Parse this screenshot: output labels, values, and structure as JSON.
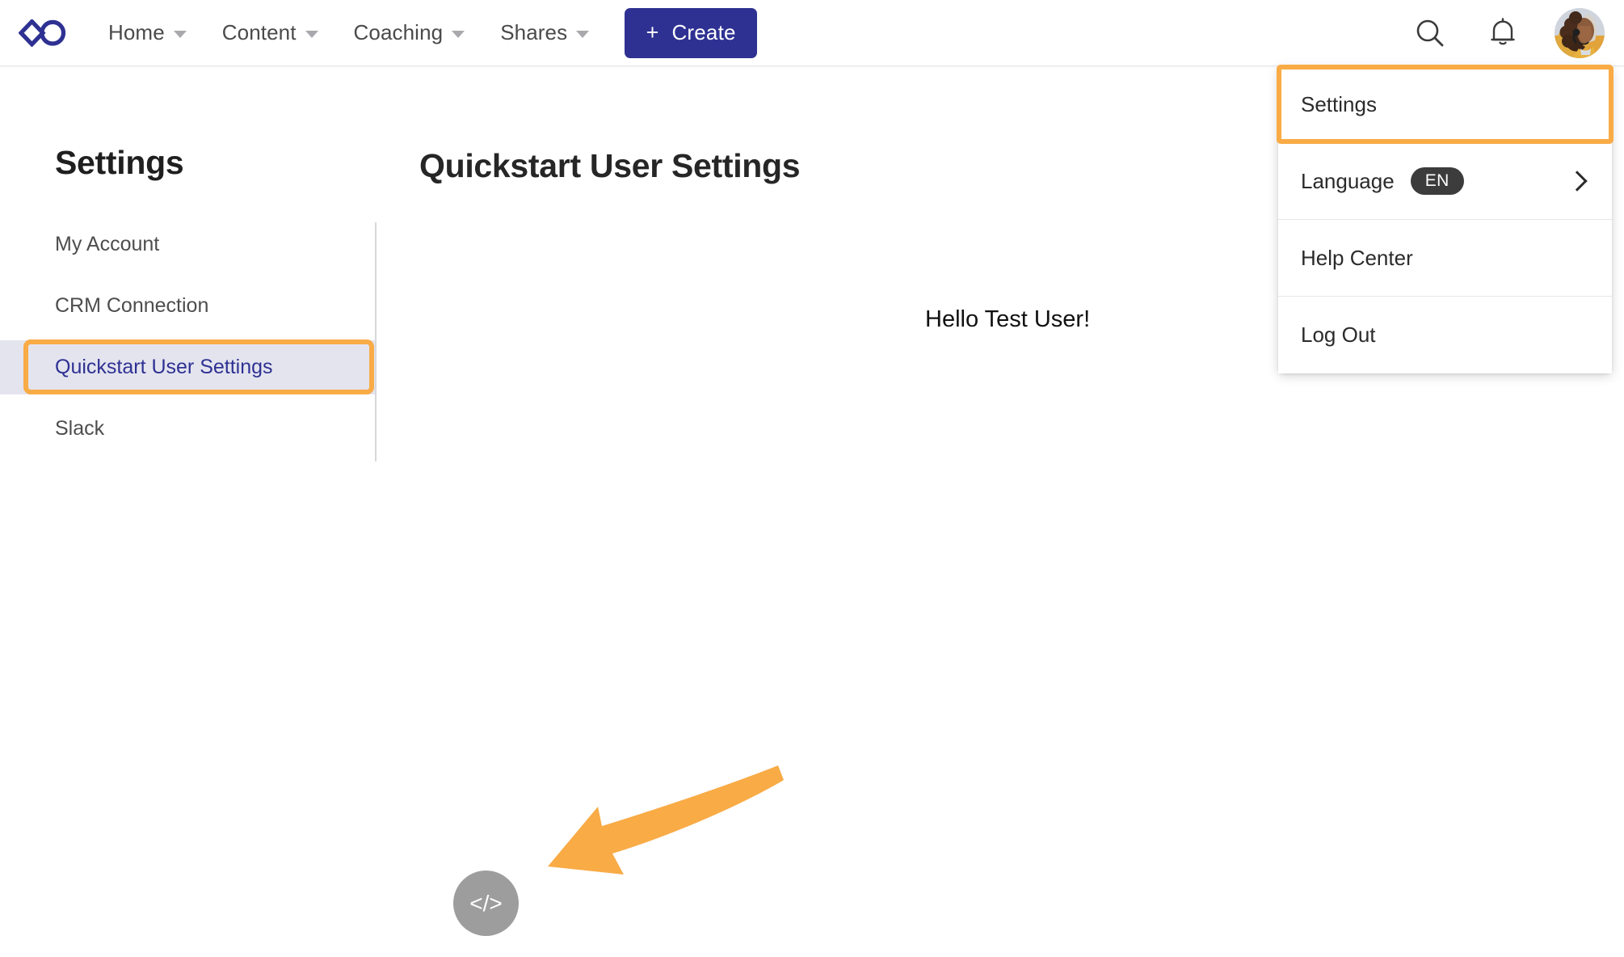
{
  "header": {
    "logo_icon": "infinity-diamond-logo",
    "nav": [
      {
        "label": "Home",
        "has_caret": true
      },
      {
        "label": "Content",
        "has_caret": true
      },
      {
        "label": "Coaching",
        "has_caret": true
      },
      {
        "label": "Shares",
        "has_caret": true
      }
    ],
    "create_button": {
      "plus": "+",
      "label": "Create"
    },
    "search_icon": "search-icon",
    "notifications_icon": "bell-icon",
    "avatar_alt": "user-avatar",
    "brand_color": "#2E3192"
  },
  "user_menu": {
    "items": [
      {
        "label": "Settings",
        "highlighted": true
      },
      {
        "label": "Language",
        "badge": "EN",
        "has_chevron": true
      },
      {
        "label": "Help Center"
      },
      {
        "label": "Log Out"
      }
    ]
  },
  "sidebar": {
    "title": "Settings",
    "items": [
      {
        "label": "My Account",
        "active": false
      },
      {
        "label": "CRM Connection",
        "active": false
      },
      {
        "label": "Quickstart User Settings",
        "active": true
      },
      {
        "label": "Slack",
        "active": false
      }
    ],
    "active_bg": "#e4e4ef",
    "active_text": "#2E3192"
  },
  "main": {
    "page_title": "Quickstart User Settings",
    "greeting": "Hello Test User!"
  },
  "annotations": {
    "highlight_color": "#F9AB46",
    "arrow_color": "#F9AB46",
    "arrow_points_to": "code-fab-button"
  },
  "code_fab": {
    "glyph": "</>",
    "icon": "code-icon",
    "bg": "#9d9d9d"
  }
}
